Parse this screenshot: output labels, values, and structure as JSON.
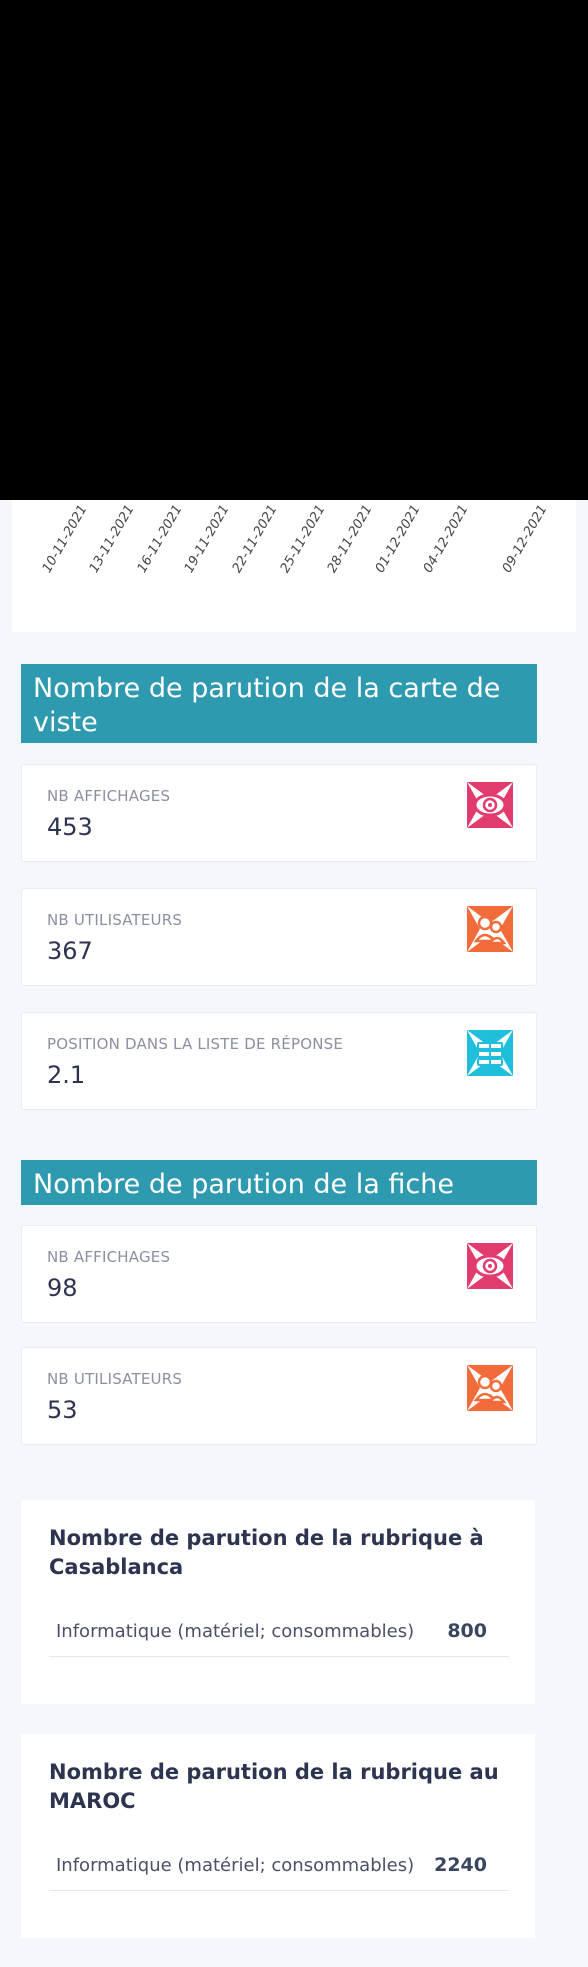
{
  "chart": {
    "x_tick_labels": [
      "10-11-2021",
      "13-11-2021",
      "16-11-2021",
      "19-11-2021",
      "22-11-2021",
      "25-11-2021",
      "28-11-2021",
      "01-12-2021",
      "04-12-2021",
      "09-12-2021"
    ]
  },
  "carte_section": {
    "title": "Nombre de parution de la carte de viste",
    "cards": [
      {
        "label": "NB AFFICHAGES",
        "value": "453",
        "icon": "eye-icon",
        "color": "#e23b6e"
      },
      {
        "label": "NB UTILISATEURS",
        "value": "367",
        "icon": "users-icon",
        "color": "#f26b3a"
      },
      {
        "label": "POSITION DANS LA LISTE DE RÉPONSE",
        "value": "2.1",
        "icon": "list-icon",
        "color": "#1fbfdc"
      }
    ]
  },
  "fiche_section": {
    "title": "Nombre de parution de la fiche",
    "cards": [
      {
        "label": "NB AFFICHAGES",
        "value": "98",
        "icon": "eye-icon",
        "color": "#e23b6e"
      },
      {
        "label": "NB UTILISATEURS",
        "value": "53",
        "icon": "users-icon",
        "color": "#f26b3a"
      }
    ]
  },
  "rubrique_casablanca": {
    "title": "Nombre de parution de la rubrique à Casablanca",
    "rows": [
      {
        "name": "Informatique (matériel; consommables)",
        "count": "800"
      }
    ]
  },
  "rubrique_maroc": {
    "title": "Nombre de parution de la rubrique au MAROC",
    "rows": [
      {
        "name": "Informatique (matériel; consommables)",
        "count": "2240"
      }
    ]
  }
}
